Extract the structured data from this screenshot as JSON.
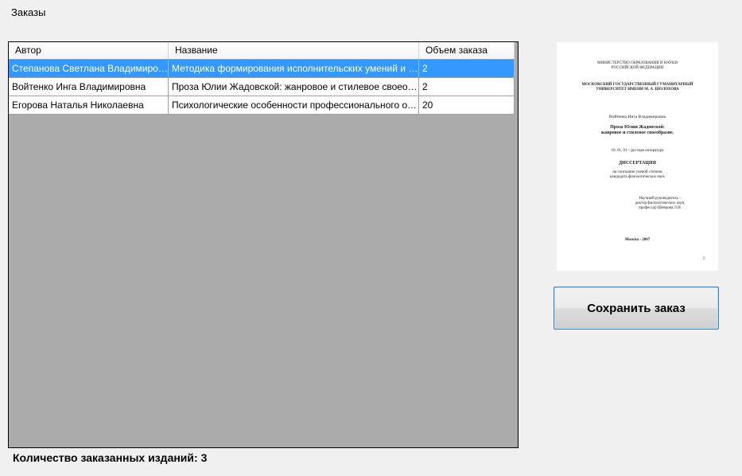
{
  "page": {
    "title": "Заказы",
    "count_label": "Количество заказанных изданий: 3",
    "save_button": "Сохранить заказ"
  },
  "grid": {
    "columns": [
      "Автор",
      "Название",
      "Объем заказа"
    ],
    "rows": [
      {
        "author": "Степанова Светлана Владимировна...",
        "title": "Методика формирования исполнительских умений и навы...",
        "volume": "2",
        "selected": true
      },
      {
        "author": "Войтенко Инга Владимировна",
        "title": "Проза Юлии Жадовской: жанровое и стилевое своеобраз...",
        "volume": "2",
        "selected": false
      },
      {
        "author": "Егорова Наталья Николаевна",
        "title": "Психологические особенности профессионального отчуж...",
        "volume": "20",
        "selected": false
      }
    ]
  },
  "preview": {
    "ministry": "МИНИСТЕРСТВО ОБРАЗОВАНИЯ И НАУКИ",
    "federation": "РОССИЙСКОЙ ФЕДЕРАЦИИ",
    "university_1": "МОСКОВСКИЙ ГОСУДАРСТВЕННЫЙ ГУМАНИТАРНЫЙ",
    "university_2": "УНИВЕРСИТЕТ ИМЕНИ М. А. ШОЛОХОВА",
    "author": "Войтенко Инга Владимировна",
    "work_title_1": "Проза Юлии Жадовской:",
    "work_title_2": "жанровое и стилевое своеобразие.",
    "specialty": "10. 01. 01 – русская литература",
    "dissertation": "ДИССЕРТАЦИЯ",
    "degree_1": "на соискание ученой степени",
    "degree_2": "кандидата филологических наук",
    "supervisor_1": "Научный руководитель –",
    "supervisor_2": "доктор филологических наук,",
    "supervisor_3": "профессор Шевцова Л.И.",
    "city_year": "Москва - 2007",
    "page_number": "1"
  }
}
